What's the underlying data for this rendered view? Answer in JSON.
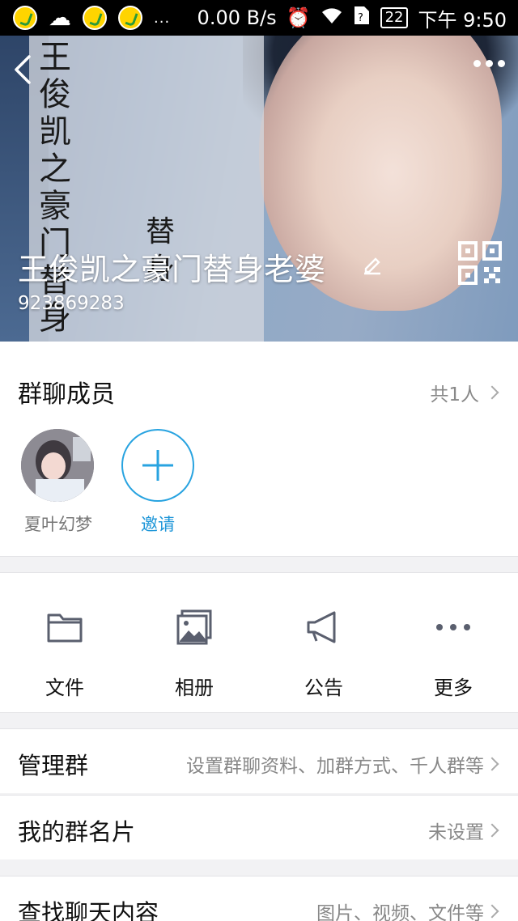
{
  "status_bar": {
    "network_speed": "0.00 B/s",
    "battery": "22",
    "time": "下午 9:50",
    "dots": "..."
  },
  "header": {
    "group_name": "王俊凯之豪门替身老婆",
    "group_id": "923869283",
    "banner_text": "王俊凯之豪门替身",
    "banner_text_lower": "替身"
  },
  "members": {
    "title": "群聊成员",
    "count": "共1人",
    "list": [
      {
        "name": "夏叶幻梦"
      }
    ],
    "invite_label": "邀请"
  },
  "features": [
    {
      "label": "文件",
      "icon": "folder-icon"
    },
    {
      "label": "相册",
      "icon": "album-icon"
    },
    {
      "label": "公告",
      "icon": "megaphone-icon"
    },
    {
      "label": "更多",
      "icon": "more-dots-icon"
    }
  ],
  "rows": {
    "manage": {
      "label": "管理群",
      "value": "设置群聊资料、加群方式、千人群等"
    },
    "card": {
      "label": "我的群名片",
      "value": "未设置"
    },
    "search": {
      "label": "查找聊天内容",
      "value": "图片、视频、文件等"
    }
  },
  "colors": {
    "accent": "#28a3e0",
    "invite_text": "#1e96d8",
    "secondary_text": "#888888"
  }
}
